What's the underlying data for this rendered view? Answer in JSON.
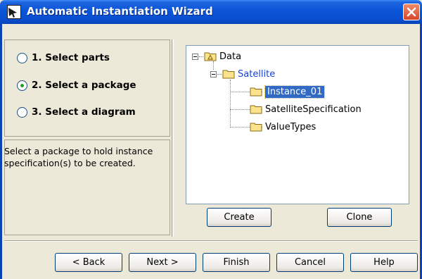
{
  "window": {
    "title": "Automatic Instantiation Wizard"
  },
  "steps": [
    {
      "label": "1. Select parts",
      "selected": false
    },
    {
      "label": "2. Select a package",
      "selected": true
    },
    {
      "label": "3. Select a diagram",
      "selected": false
    }
  ],
  "description": "Select a package to hold instance specification(s) to be created.",
  "tree": {
    "root": "Data",
    "child": "Satellite",
    "leaves": [
      "Instance_01",
      "SatelliteSpecification",
      "ValueTypes"
    ],
    "selected": "Instance_01"
  },
  "tree_buttons": {
    "create": "Create",
    "clone": "Clone"
  },
  "footer_buttons": {
    "back": "< Back",
    "next": "Next >",
    "finish": "Finish",
    "cancel": "Cancel",
    "help": "Help"
  },
  "icons": {
    "app": "wizard-icon",
    "close": "close-icon",
    "folder": "folder-icon"
  },
  "colors": {
    "titlebar": "#0a55d8",
    "selection": "#316ac5",
    "link": "#1a3fd6"
  }
}
